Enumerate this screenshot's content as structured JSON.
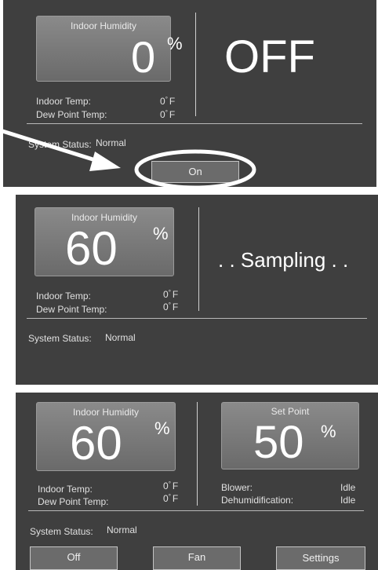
{
  "panel1": {
    "tile_title": "Indoor Humidity",
    "humidity_value": "0",
    "percent": "%",
    "state_text": "OFF",
    "indoor_temp_label": "Indoor Temp:",
    "indoor_temp_value": "0",
    "dew_point_label": "Dew Point Temp:",
    "dew_point_value": "0",
    "unit_degree": "°",
    "unit_f": "F",
    "status_label": "System Status:",
    "status_value": "Normal",
    "on_button": "On"
  },
  "panel2": {
    "tile_title": "Indoor Humidity",
    "humidity_value": "60",
    "percent": "%",
    "state_text": ". . Sampling . .",
    "indoor_temp_label": "Indoor Temp:",
    "indoor_temp_value": "0",
    "dew_point_label": "Dew Point Temp:",
    "dew_point_value": "0",
    "unit_degree": "°",
    "unit_f": "F",
    "status_label": "System Status:",
    "status_value": "Normal"
  },
  "panel3": {
    "tile_title": "Indoor Humidity",
    "humidity_value": "60",
    "percent": "%",
    "setpoint_title": "Set Point",
    "setpoint_value": "50",
    "setpoint_percent": "%",
    "indoor_temp_label": "Indoor Temp:",
    "indoor_temp_value": "0",
    "dew_point_label": "Dew Point Temp:",
    "dew_point_value": "0",
    "unit_degree": "°",
    "unit_f": "F",
    "blower_label": "Blower:",
    "blower_value": "Idle",
    "dehum_label": "Dehumidification:",
    "dehum_value": "Idle",
    "status_label": "System Status:",
    "status_value": "Normal",
    "off_button": "Off",
    "fan_button": "Fan",
    "settings_button": "Settings"
  },
  "colors": {
    "panel_bg": "#3f3f3f",
    "tile_bg": "#7a7a7a",
    "annotation": "#ffffff"
  }
}
